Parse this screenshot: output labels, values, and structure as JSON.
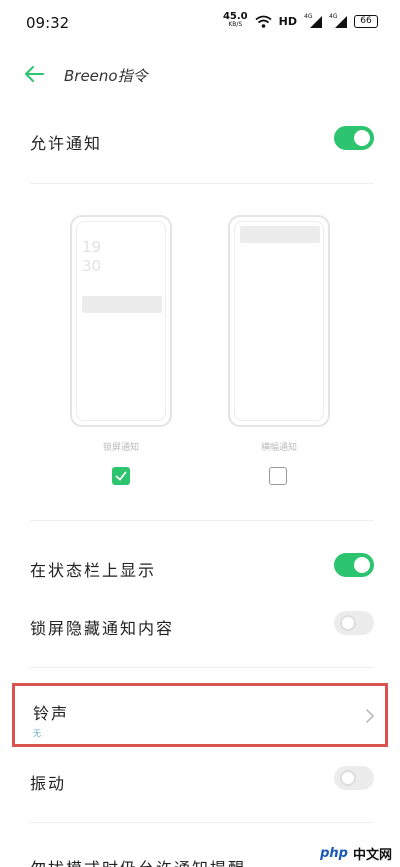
{
  "status_bar": {
    "time": "09:32",
    "net_speed": "45.0",
    "net_speed_unit": "KB/S",
    "hd": "HD",
    "sig1_label": "4G",
    "sig2_label": "4G",
    "battery": "66"
  },
  "header": {
    "back_icon": "arrow-left-icon",
    "title": "Breeno指令"
  },
  "allow_notifications": {
    "label": "允许通知",
    "enabled": true
  },
  "preview": {
    "lockscreen_time_line1": "19",
    "lockscreen_time_line2": "30",
    "lockscreen_caption": "锁屏通知",
    "banner_caption": "横幅通知",
    "lockscreen_checked": true,
    "banner_checked": false
  },
  "status_bar_display": {
    "label": "在状态栏上显示",
    "enabled": true
  },
  "hide_lockscreen_content": {
    "label": "锁屏隐藏通知内容",
    "enabled": false
  },
  "ringtone": {
    "label": "铃声",
    "value": "无",
    "chevron_icon": "chevron-right-icon"
  },
  "vibration": {
    "label": "振动",
    "enabled": false
  },
  "dnd_row": {
    "label": "勿扰模式时仍允许通知提醒"
  },
  "watermark": {
    "logo": "php",
    "text": "中文网"
  },
  "colors": {
    "accent": "#2cc46e",
    "highlight_border": "#d9534f"
  }
}
